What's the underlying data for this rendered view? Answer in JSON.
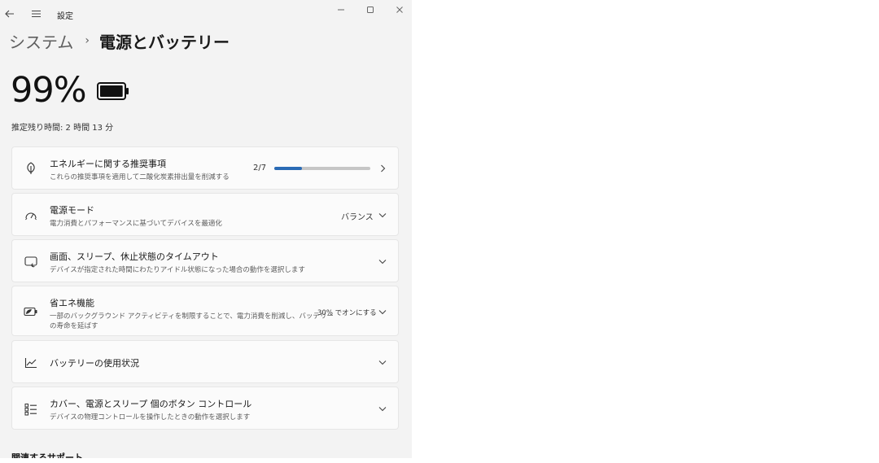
{
  "window": {
    "title": "設定"
  },
  "breadcrumb": {
    "parent": "システム",
    "separator": "›",
    "current": "電源とバッテリー"
  },
  "battery": {
    "percent_label": "99%",
    "level": 0.99,
    "remaining": "推定残り時間: 2 時間 13 分"
  },
  "cards": {
    "energy": {
      "title": "エネルギーに関する推奨事項",
      "desc": "これらの推奨事項を適用して二酸化炭素排出量を削減する",
      "progress_label": "2/7",
      "progress_value": 2,
      "progress_max": 7
    },
    "power_mode": {
      "title": "電源モード",
      "desc": "電力消費とパフォーマンスに基づいてデバイスを最適化",
      "value": "バランス"
    },
    "screen_sleep": {
      "title": "画面、スリープ、休止状態のタイムアウト",
      "desc": "デバイスが指定された時間にわたりアイドル状態になった場合の動作を選択します"
    },
    "battery_saver": {
      "title": "省エネ機能",
      "desc_line1": "一部のバックグラウンド アクティビティを制限することで、電力消費を削減し、バッテリー",
      "desc_line2": "の寿命を延ばす",
      "value": "30% でオンにする"
    },
    "battery_usage": {
      "title": "バッテリーの使用状況"
    },
    "buttons": {
      "title": "カバー、電源とスリープ 個のボタン コントロール",
      "desc": "デバイスの物理コントロールを操作したときの動作を選択します"
    }
  },
  "related": {
    "title": "関連するサポート"
  },
  "icons": {
    "back": "back-arrow-icon",
    "menu": "hamburger-menu-icon",
    "energy": "leaf-icon",
    "power_mode": "power-mode-gauge-icon",
    "screen_sleep": "screen-sleep-icon",
    "battery_saver": "battery-saver-icon",
    "battery_usage": "line-chart-icon",
    "buttons": "button-controls-icon"
  },
  "colors": {
    "accent": "#2a6bb5",
    "window_bg": "#f3f3f3",
    "card_bg": "#fbfbfb"
  }
}
